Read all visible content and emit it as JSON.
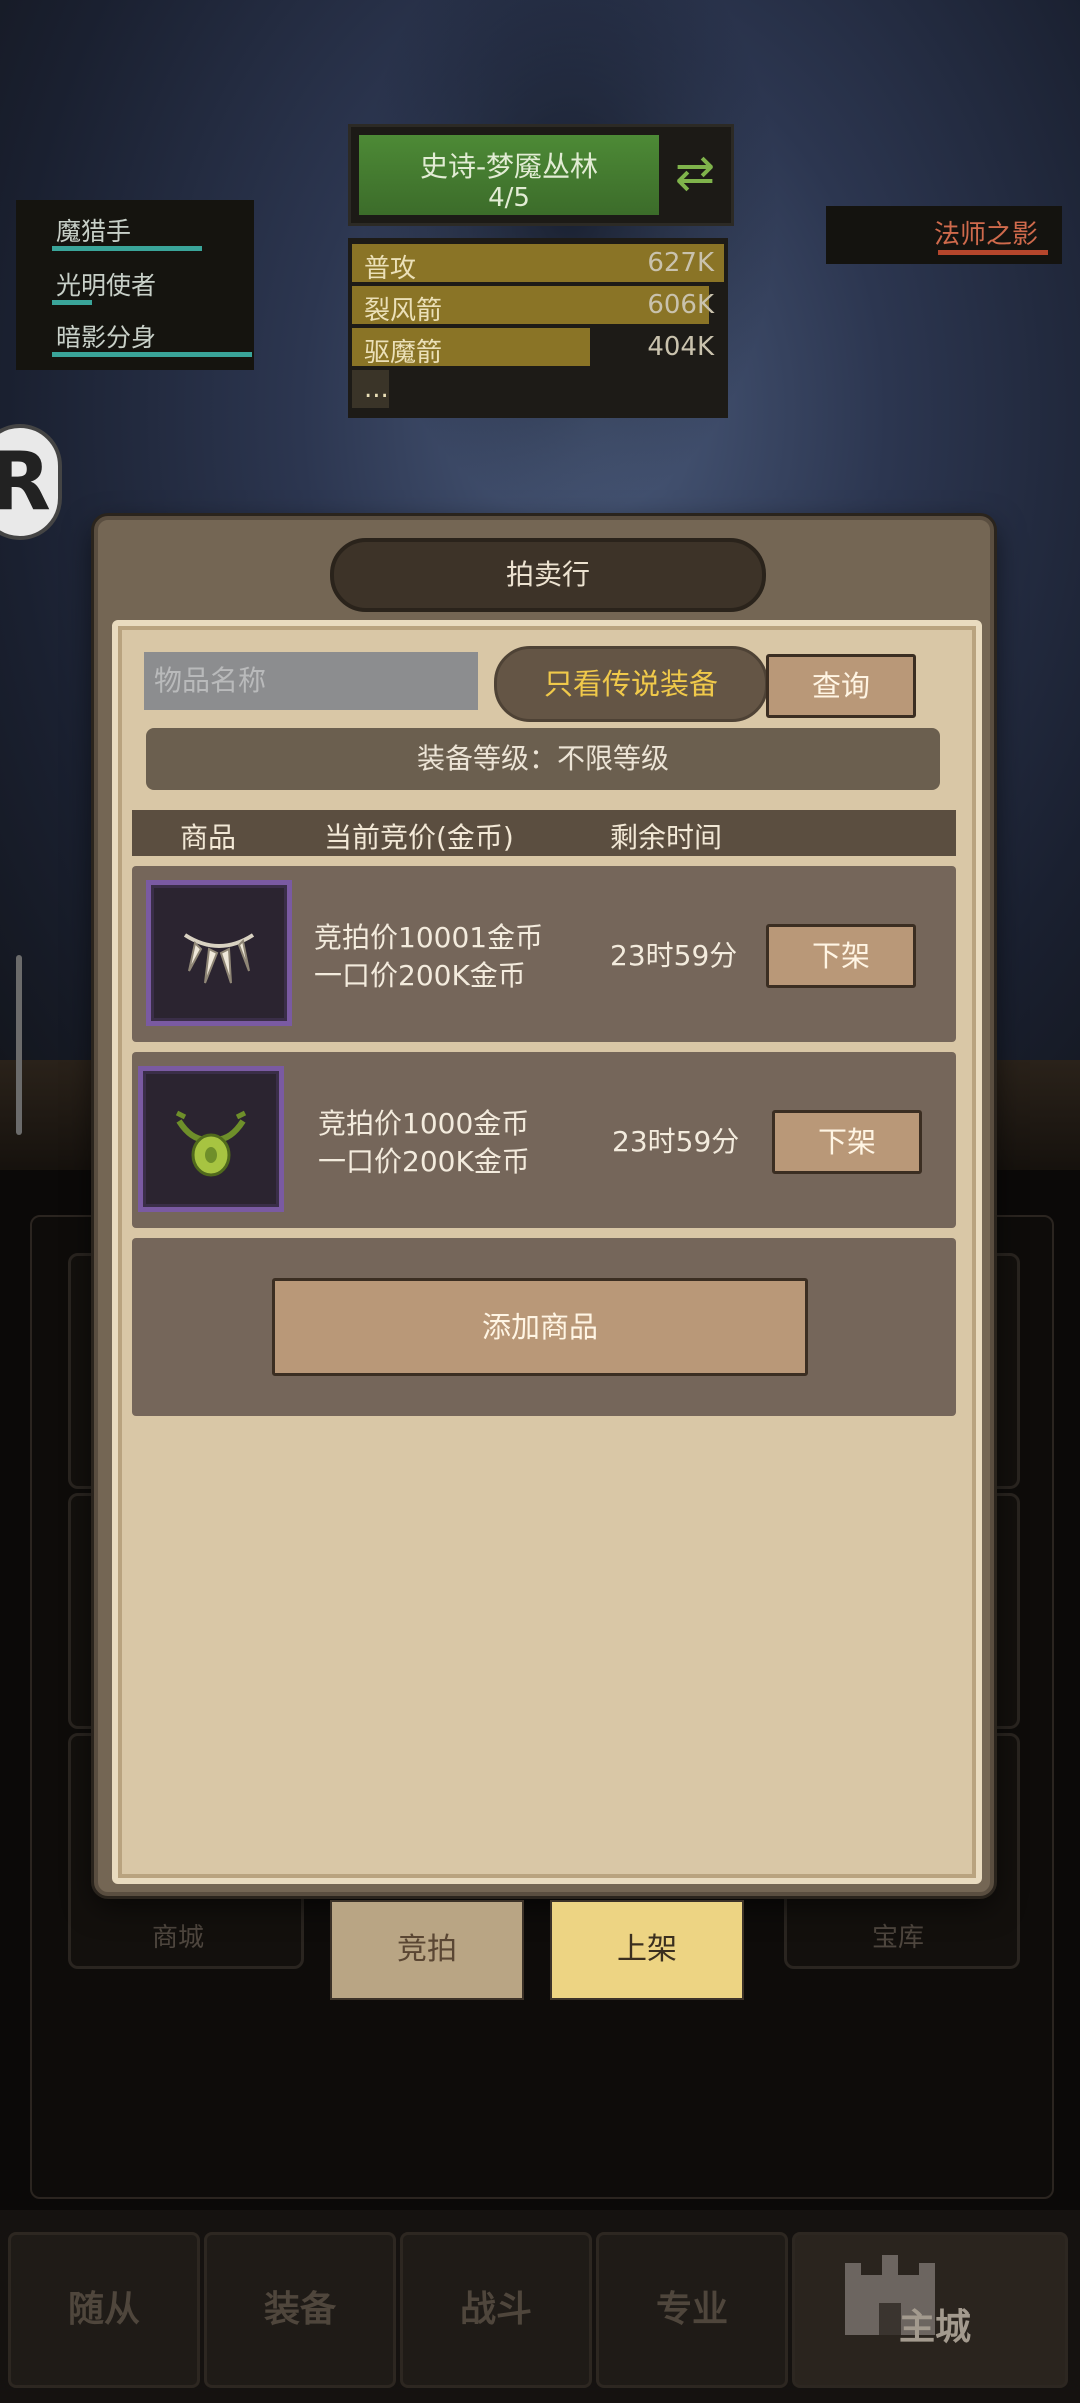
{
  "hud": {
    "stage_title": "史诗-梦魇丛林",
    "stage_progress": "4/5",
    "damage_rows": [
      {
        "name": "普攻",
        "value": "627K",
        "fill": 1.0
      },
      {
        "name": "裂风箭",
        "value": "606K",
        "fill": 0.96
      },
      {
        "name": "驱魔箭",
        "value": "404K",
        "fill": 0.64
      },
      {
        "name": "...",
        "value": "",
        "fill": 0.1
      }
    ],
    "party": [
      "魔猎手",
      "光明使者",
      "暗影分身"
    ],
    "enemy": "法师之影"
  },
  "auction": {
    "title": "拍卖行",
    "search_placeholder": "物品名称",
    "legend_only_label": "只看传说装备",
    "query_label": "查询",
    "level_filter": "装备等级：不限等级",
    "columns": [
      "商品",
      "当前竞价(金币)",
      "剩余时间"
    ],
    "items": [
      {
        "bid": "竞拍价10001金币",
        "buyout": "一口价200K金币",
        "time": "23时59分",
        "action": "下架",
        "icon": "fang-necklace-icon"
      },
      {
        "bid": "竞拍价1000金币",
        "buyout": "一口价200K金币",
        "time": "23时59分",
        "action": "下架",
        "icon": "green-amulet-icon"
      }
    ],
    "add_label": "添加商品"
  },
  "bottom_tabs": {
    "auction": "竞拍",
    "list": "上架"
  },
  "background_labels": {
    "shop": "商城",
    "vault": "宝库"
  },
  "nav": [
    "随从",
    "装备",
    "战斗",
    "专业",
    "主城"
  ],
  "colors": {
    "accent_gold": "#f0c94a",
    "item_frame": "#7a5aa2",
    "panel": "#746654"
  }
}
